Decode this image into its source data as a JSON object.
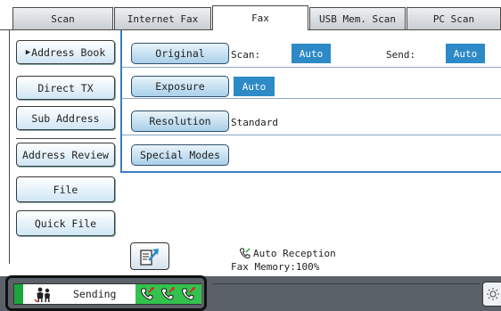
{
  "tabs": [
    {
      "label": "Scan",
      "active": false
    },
    {
      "label": "Internet Fax",
      "active": false
    },
    {
      "label": "Fax",
      "active": true
    },
    {
      "label": "USB Mem. Scan",
      "active": false
    },
    {
      "label": "PC Scan",
      "active": false
    }
  ],
  "sidebar": {
    "address_book": "Address Book",
    "direct_tx": "Direct TX",
    "sub_address": "Sub Address",
    "address_review": "Address Review",
    "file": "File",
    "quick_file": "Quick File"
  },
  "settings": {
    "original": {
      "label": "Original",
      "scan_label": "Scan:",
      "scan_value": "Auto",
      "send_label": "Send:",
      "send_value": "Auto"
    },
    "exposure": {
      "label": "Exposure",
      "value": "Auto"
    },
    "resolution": {
      "label": "Resolution",
      "value": "Standard"
    },
    "special_modes": {
      "label": "Special Modes"
    }
  },
  "status": {
    "auto_reception": "Auto Reception",
    "fax_memory": "Fax Memory:100%"
  },
  "job": {
    "state": "Sending",
    "line_count_icons": [
      "phone-icon",
      "phone-icon",
      "phone-icon"
    ]
  },
  "colors": {
    "accent_blue": "#2d8ac7",
    "status_green": "#33c24d",
    "statusbar_gray": "#5a6168"
  }
}
